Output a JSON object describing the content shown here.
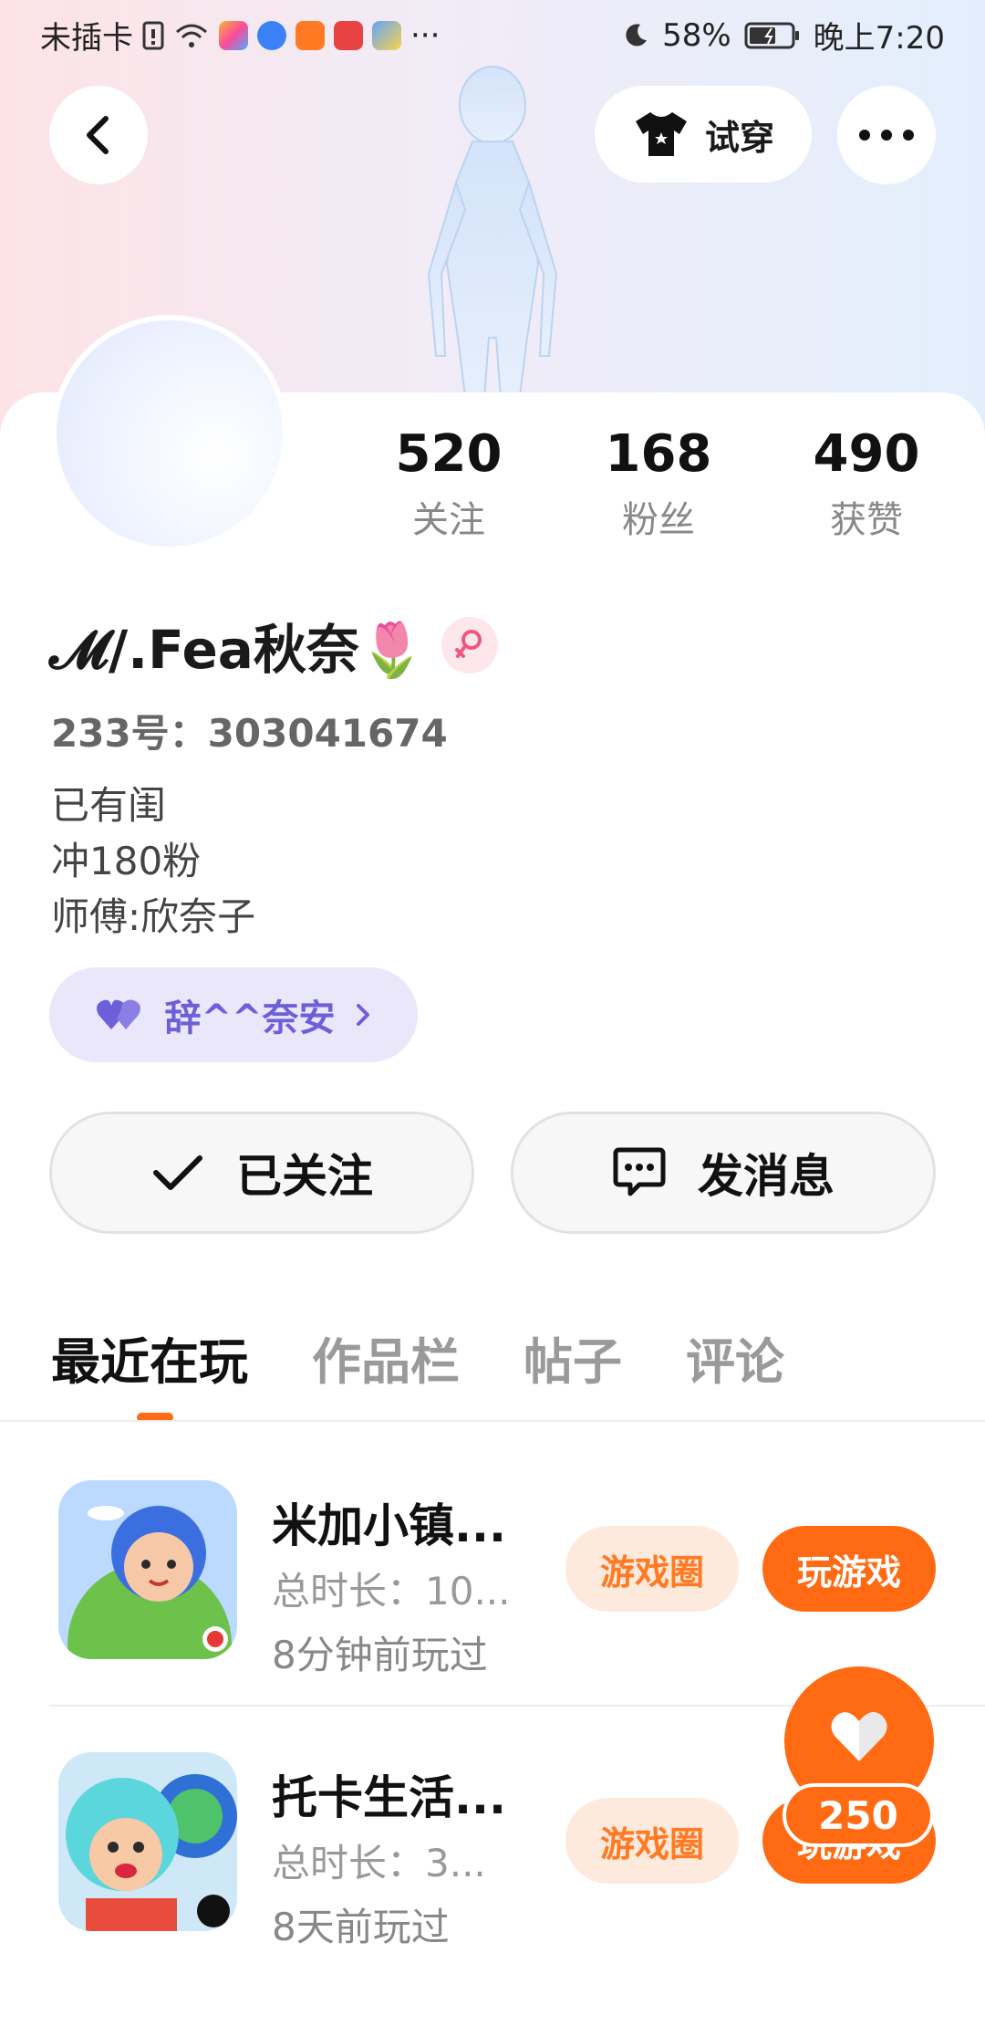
{
  "status_bar": {
    "carrier": "未插卡",
    "battery": "58%",
    "time": "晚上7:20",
    "more": "···"
  },
  "header": {
    "try_on_label": "试穿",
    "back_icon": "back-arrow-icon",
    "more_icon": "more-dots-icon"
  },
  "profile": {
    "stats": [
      {
        "value": "520",
        "label": "关注"
      },
      {
        "value": "168",
        "label": "粉丝"
      },
      {
        "value": "490",
        "label": "获赞"
      }
    ],
    "name": "𝓜/.Fea秋奈🌷",
    "gender": "female",
    "id_label": "233号：",
    "id_value": "303041674",
    "bio_lines": [
      "已有闺",
      "冲180粉",
      "师傅:欣奈子"
    ],
    "guild_name": "辞^^奈安",
    "follow_label": "已关注",
    "message_label": "发消息"
  },
  "tabs": [
    "最近在玩",
    "作品栏",
    "帖子",
    "评论"
  ],
  "games": [
    {
      "title": "米加小镇...",
      "duration": "总时长：10...",
      "last_played": "8分钟前玩过",
      "circle_label": "游戏圈",
      "play_label": "玩游戏"
    },
    {
      "title": "托卡生活...",
      "duration": "总时长：3...",
      "last_played": "8天前玩过",
      "circle_label": "游戏圈",
      "play_label": "玩游戏"
    }
  ],
  "fab": {
    "count": "250"
  },
  "colors": {
    "accent": "#ff6a13",
    "guild_purple": "#6d5fd8",
    "guild_bg": "#ebe7fb",
    "pill_bg": "#fdeadd"
  }
}
